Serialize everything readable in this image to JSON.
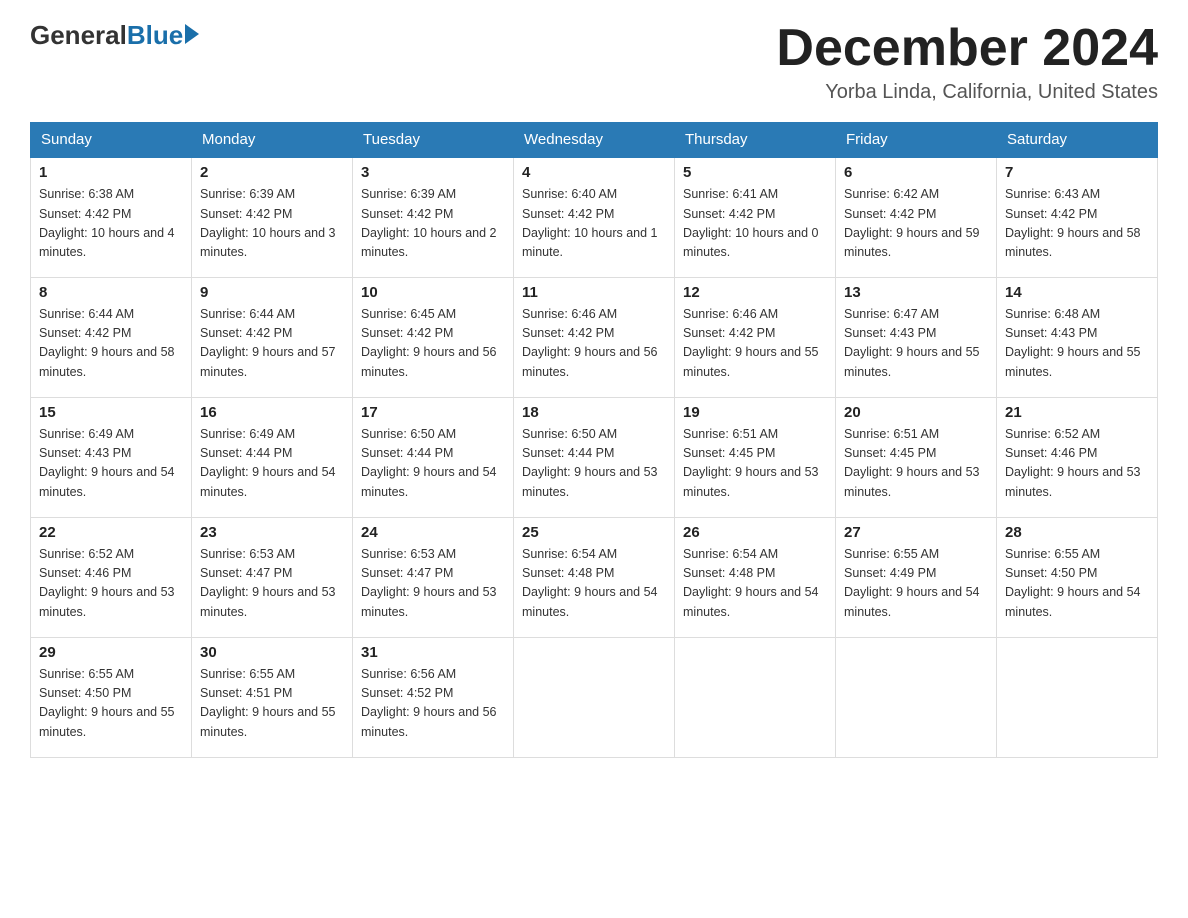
{
  "header": {
    "logo_general": "General",
    "logo_blue": "Blue",
    "month_title": "December 2024",
    "location": "Yorba Linda, California, United States"
  },
  "days_of_week": [
    "Sunday",
    "Monday",
    "Tuesday",
    "Wednesday",
    "Thursday",
    "Friday",
    "Saturday"
  ],
  "weeks": [
    [
      {
        "num": "1",
        "sunrise": "6:38 AM",
        "sunset": "4:42 PM",
        "daylight": "10 hours and 4 minutes."
      },
      {
        "num": "2",
        "sunrise": "6:39 AM",
        "sunset": "4:42 PM",
        "daylight": "10 hours and 3 minutes."
      },
      {
        "num": "3",
        "sunrise": "6:39 AM",
        "sunset": "4:42 PM",
        "daylight": "10 hours and 2 minutes."
      },
      {
        "num": "4",
        "sunrise": "6:40 AM",
        "sunset": "4:42 PM",
        "daylight": "10 hours and 1 minute."
      },
      {
        "num": "5",
        "sunrise": "6:41 AM",
        "sunset": "4:42 PM",
        "daylight": "10 hours and 0 minutes."
      },
      {
        "num": "6",
        "sunrise": "6:42 AM",
        "sunset": "4:42 PM",
        "daylight": "9 hours and 59 minutes."
      },
      {
        "num": "7",
        "sunrise": "6:43 AM",
        "sunset": "4:42 PM",
        "daylight": "9 hours and 58 minutes."
      }
    ],
    [
      {
        "num": "8",
        "sunrise": "6:44 AM",
        "sunset": "4:42 PM",
        "daylight": "9 hours and 58 minutes."
      },
      {
        "num": "9",
        "sunrise": "6:44 AM",
        "sunset": "4:42 PM",
        "daylight": "9 hours and 57 minutes."
      },
      {
        "num": "10",
        "sunrise": "6:45 AM",
        "sunset": "4:42 PM",
        "daylight": "9 hours and 56 minutes."
      },
      {
        "num": "11",
        "sunrise": "6:46 AM",
        "sunset": "4:42 PM",
        "daylight": "9 hours and 56 minutes."
      },
      {
        "num": "12",
        "sunrise": "6:46 AM",
        "sunset": "4:42 PM",
        "daylight": "9 hours and 55 minutes."
      },
      {
        "num": "13",
        "sunrise": "6:47 AM",
        "sunset": "4:43 PM",
        "daylight": "9 hours and 55 minutes."
      },
      {
        "num": "14",
        "sunrise": "6:48 AM",
        "sunset": "4:43 PM",
        "daylight": "9 hours and 55 minutes."
      }
    ],
    [
      {
        "num": "15",
        "sunrise": "6:49 AM",
        "sunset": "4:43 PM",
        "daylight": "9 hours and 54 minutes."
      },
      {
        "num": "16",
        "sunrise": "6:49 AM",
        "sunset": "4:44 PM",
        "daylight": "9 hours and 54 minutes."
      },
      {
        "num": "17",
        "sunrise": "6:50 AM",
        "sunset": "4:44 PM",
        "daylight": "9 hours and 54 minutes."
      },
      {
        "num": "18",
        "sunrise": "6:50 AM",
        "sunset": "4:44 PM",
        "daylight": "9 hours and 53 minutes."
      },
      {
        "num": "19",
        "sunrise": "6:51 AM",
        "sunset": "4:45 PM",
        "daylight": "9 hours and 53 minutes."
      },
      {
        "num": "20",
        "sunrise": "6:51 AM",
        "sunset": "4:45 PM",
        "daylight": "9 hours and 53 minutes."
      },
      {
        "num": "21",
        "sunrise": "6:52 AM",
        "sunset": "4:46 PM",
        "daylight": "9 hours and 53 minutes."
      }
    ],
    [
      {
        "num": "22",
        "sunrise": "6:52 AM",
        "sunset": "4:46 PM",
        "daylight": "9 hours and 53 minutes."
      },
      {
        "num": "23",
        "sunrise": "6:53 AM",
        "sunset": "4:47 PM",
        "daylight": "9 hours and 53 minutes."
      },
      {
        "num": "24",
        "sunrise": "6:53 AM",
        "sunset": "4:47 PM",
        "daylight": "9 hours and 53 minutes."
      },
      {
        "num": "25",
        "sunrise": "6:54 AM",
        "sunset": "4:48 PM",
        "daylight": "9 hours and 54 minutes."
      },
      {
        "num": "26",
        "sunrise": "6:54 AM",
        "sunset": "4:48 PM",
        "daylight": "9 hours and 54 minutes."
      },
      {
        "num": "27",
        "sunrise": "6:55 AM",
        "sunset": "4:49 PM",
        "daylight": "9 hours and 54 minutes."
      },
      {
        "num": "28",
        "sunrise": "6:55 AM",
        "sunset": "4:50 PM",
        "daylight": "9 hours and 54 minutes."
      }
    ],
    [
      {
        "num": "29",
        "sunrise": "6:55 AM",
        "sunset": "4:50 PM",
        "daylight": "9 hours and 55 minutes."
      },
      {
        "num": "30",
        "sunrise": "6:55 AM",
        "sunset": "4:51 PM",
        "daylight": "9 hours and 55 minutes."
      },
      {
        "num": "31",
        "sunrise": "6:56 AM",
        "sunset": "4:52 PM",
        "daylight": "9 hours and 56 minutes."
      },
      null,
      null,
      null,
      null
    ]
  ]
}
